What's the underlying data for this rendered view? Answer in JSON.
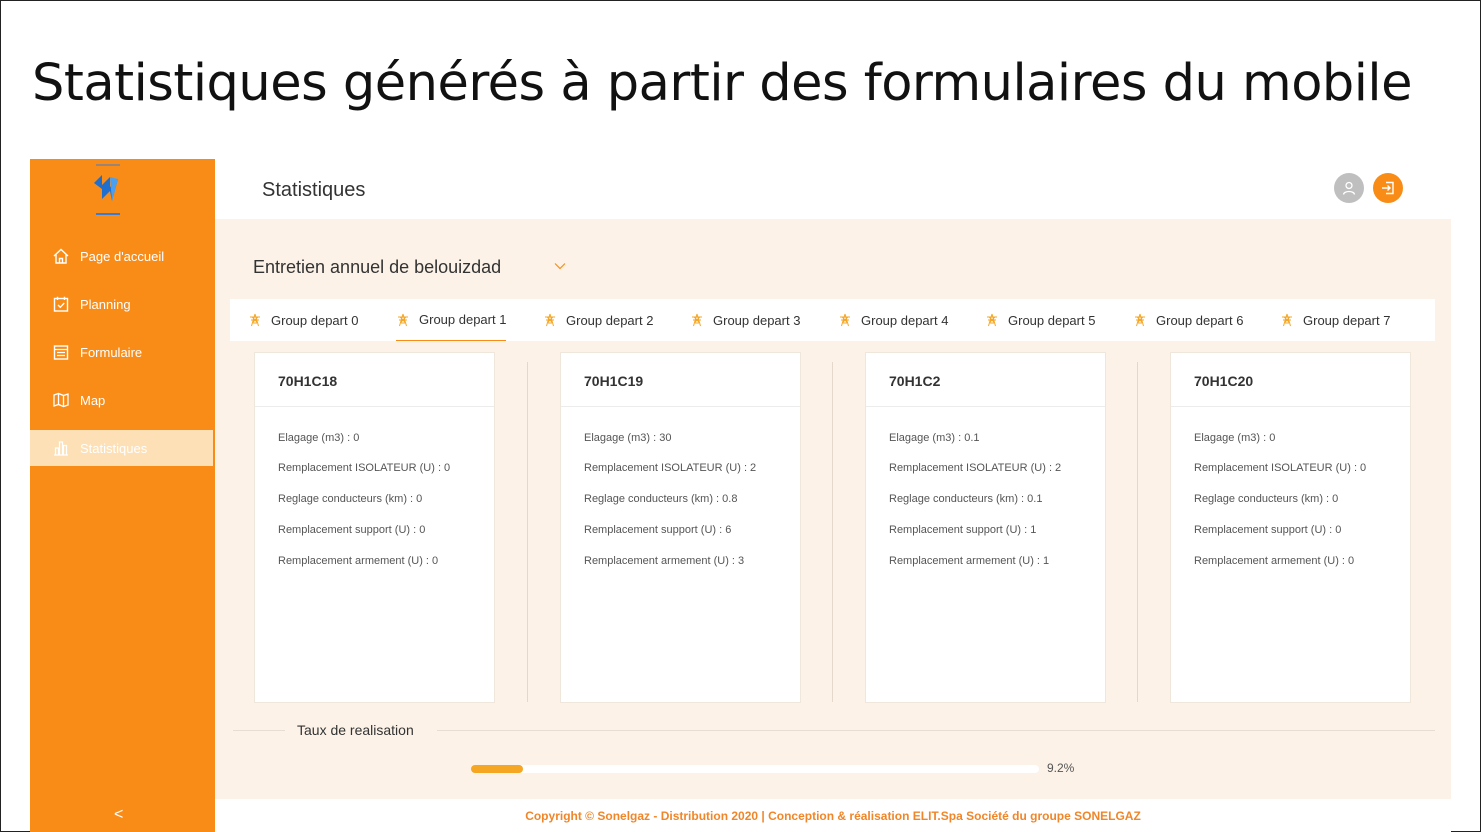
{
  "slide": {
    "title": "Statistiques générés à partir des formulaires du mobile"
  },
  "sidebar": {
    "logo": "sonelgaz-logo",
    "items": [
      {
        "label": "Page d'accueil",
        "icon": "home-icon",
        "active": false
      },
      {
        "label": "Planning",
        "icon": "calendar-check-icon",
        "active": false
      },
      {
        "label": "Formulaire",
        "icon": "form-icon",
        "active": false
      },
      {
        "label": "Map",
        "icon": "map-icon",
        "active": false
      },
      {
        "label": "Statistiques",
        "icon": "bar-chart-icon",
        "active": true
      }
    ],
    "collapse_label": "<"
  },
  "header": {
    "title": "Statistiques",
    "user_icon": "user-icon",
    "logout_icon": "logout-icon"
  },
  "filter": {
    "selected": "Entretien annuel de belouizdad"
  },
  "tabs": [
    {
      "label": "Group depart 0",
      "active": false
    },
    {
      "label": "Group depart 1",
      "active": true
    },
    {
      "label": "Group depart 2",
      "active": false
    },
    {
      "label": "Group depart 3",
      "active": false
    },
    {
      "label": "Group depart 4",
      "active": false
    },
    {
      "label": "Group depart 5",
      "active": false
    },
    {
      "label": "Group depart 6",
      "active": false
    },
    {
      "label": "Group depart 7",
      "active": false
    }
  ],
  "cards": [
    {
      "title": "70H1C18",
      "lines": [
        "Elagage (m3) : 0",
        "Remplacement ISOLATEUR (U) : 0",
        "Reglage conducteurs (km) : 0",
        "Remplacement support (U) : 0",
        "Remplacement armement (U) : 0"
      ]
    },
    {
      "title": "70H1C19",
      "lines": [
        "Elagage (m3) : 30",
        "Remplacement ISOLATEUR (U) : 2",
        "Reglage conducteurs (km) : 0.8",
        "Remplacement support (U) : 6",
        "Remplacement armement (U) : 3"
      ]
    },
    {
      "title": "70H1C2",
      "lines": [
        "Elagage (m3) : 0.1",
        "Remplacement ISOLATEUR (U) : 2",
        "Reglage conducteurs (km) : 0.1",
        "Remplacement support (U) : 1",
        "Remplacement armement (U) : 1"
      ]
    },
    {
      "title": "70H1C20",
      "lines": [
        "Elagage (m3) : 0",
        "Remplacement ISOLATEUR (U) : 0",
        "Reglage conducteurs (km) : 0",
        "Remplacement support (U) : 0",
        "Remplacement armement (U) : 0"
      ]
    }
  ],
  "rate": {
    "label": "Taux de realisation",
    "percent": 9.2,
    "text": "9.2%"
  },
  "footer": {
    "text": "Copyright © Sonelgaz - Distribution 2020 | Conception & réalisation ELIT.Spa Société du groupe SONELGAZ"
  },
  "colors": {
    "brand": "#f98c17",
    "active_nav": "#fde0b6",
    "progress": "#f5a623",
    "content_bg": "#fcf2e8"
  }
}
